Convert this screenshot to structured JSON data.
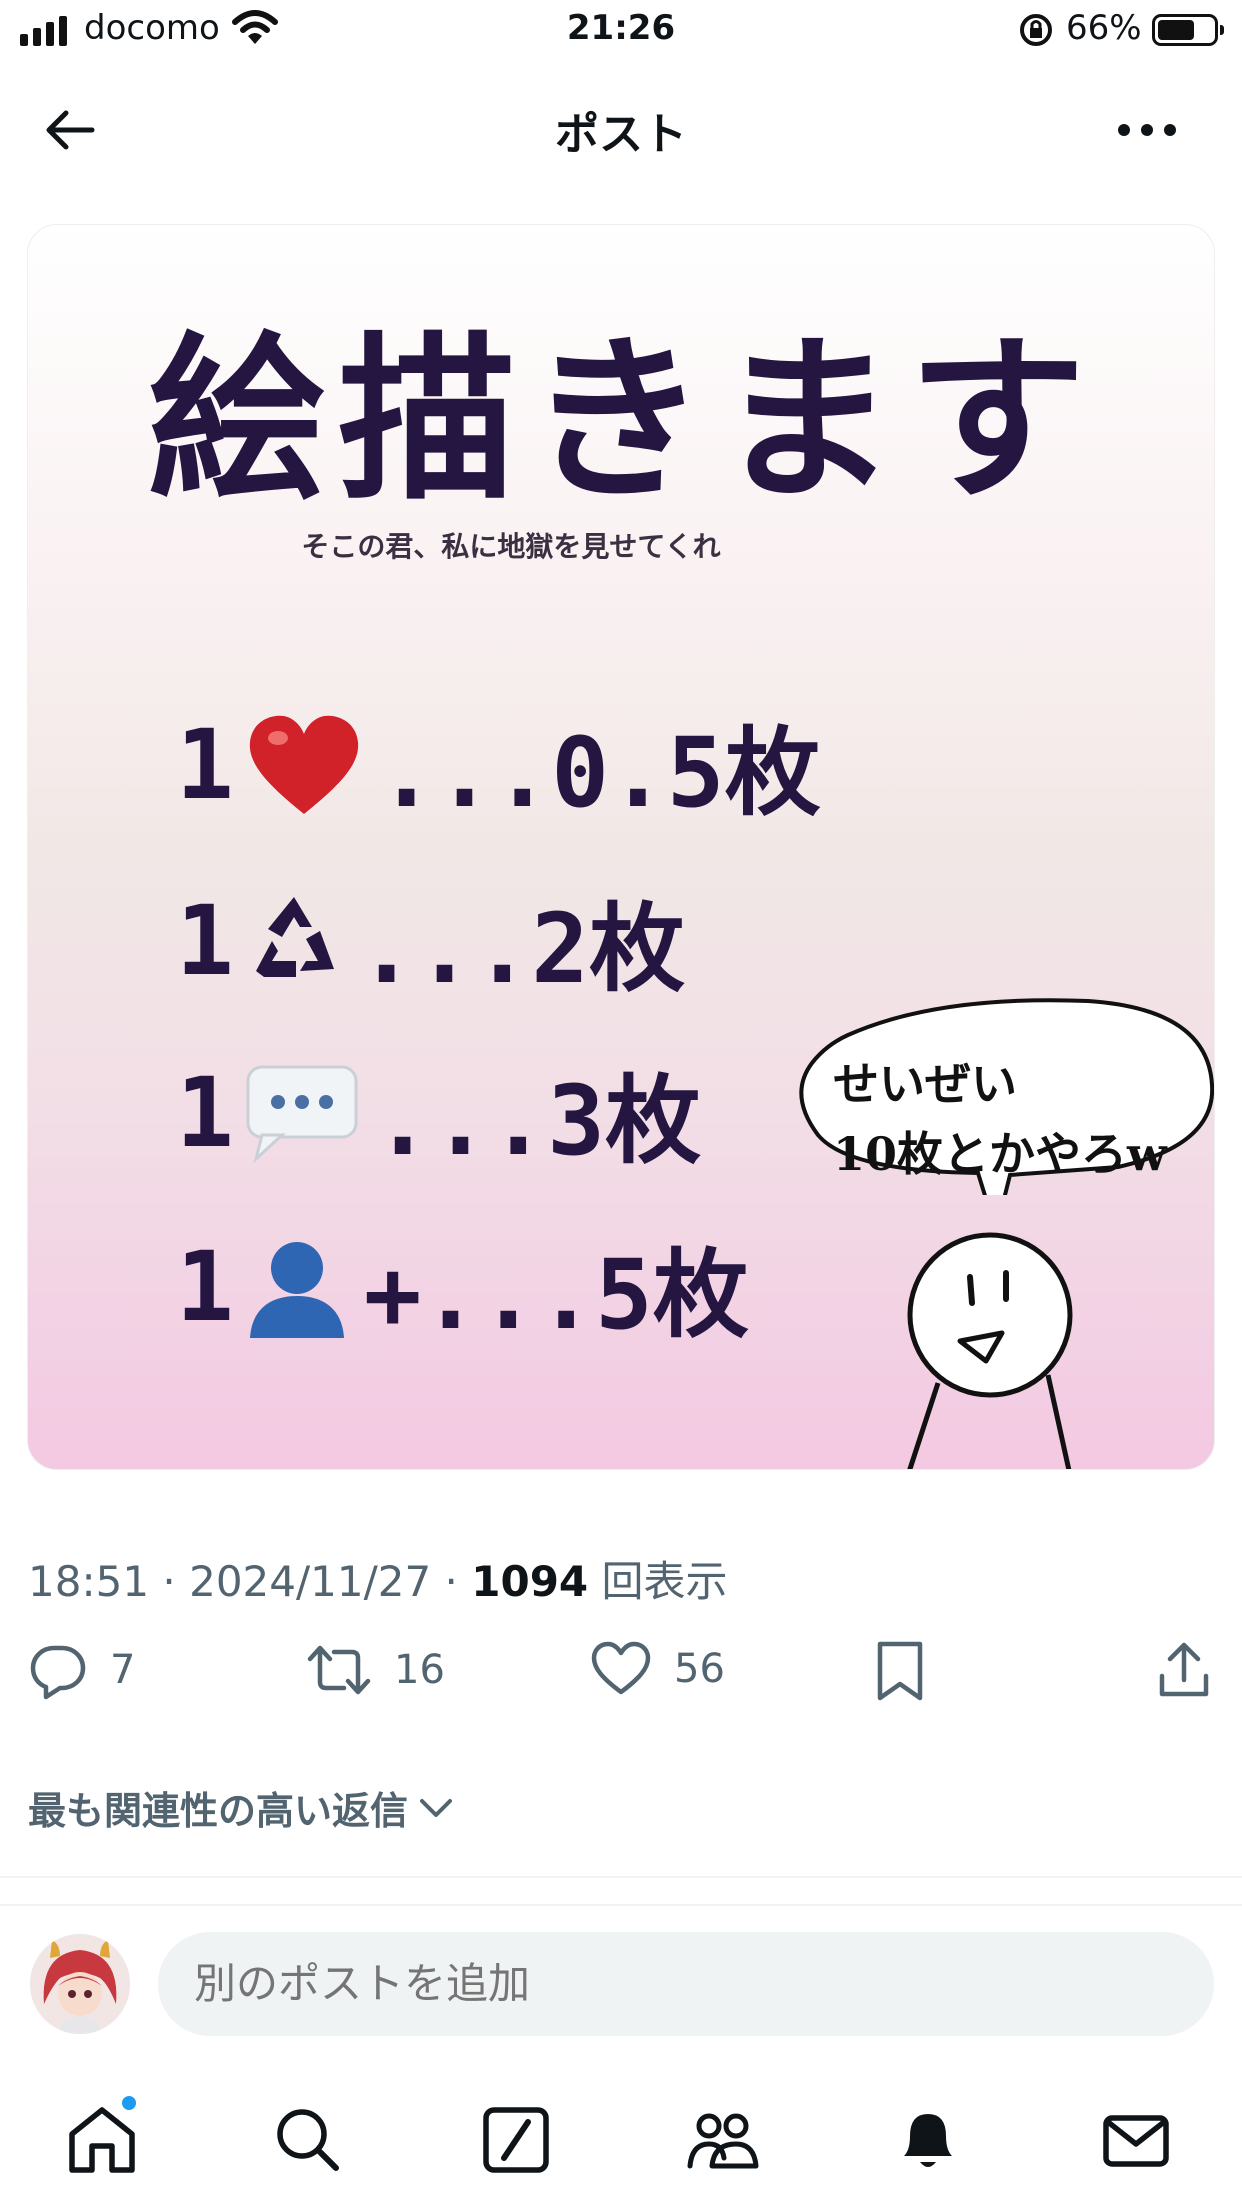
{
  "status_bar": {
    "carrier": "docomo",
    "time": "21:26",
    "battery_percent": "66%",
    "battery_level": 0.66
  },
  "header": {
    "title": "ポスト",
    "back_icon": "arrow-left-icon",
    "more_icon": "ellipsis-icon"
  },
  "post_image": {
    "headline": "絵描きます",
    "subtitle": "そこの君、私に地獄を見せてくれ",
    "rates": [
      {
        "count": "1",
        "icon": "heart-icon",
        "rate": "...0.5枚"
      },
      {
        "count": "1",
        "icon": "recycle-icon",
        "rate": "...2枚"
      },
      {
        "count": "1",
        "icon": "speech-bubble-icon",
        "rate": "...3枚"
      },
      {
        "count": "1",
        "icon": "person-icon",
        "rate": "+...5枚"
      }
    ],
    "speech_line1": "せいぜい",
    "speech_line2": "10枚とかやろw"
  },
  "meta": {
    "time": "18:51",
    "date": "2024/11/27",
    "views_count": "1094",
    "views_label": "回表示"
  },
  "actions": {
    "reply_count": "7",
    "repost_count": "16",
    "like_count": "56"
  },
  "sort_label": "最も関連性の高い返信",
  "reply_input": {
    "placeholder": "別のポストを追加"
  },
  "colors": {
    "accent": "#1d9bf0",
    "headline": "#241641",
    "muted": "#536471"
  },
  "tabs": [
    "home-icon",
    "search-icon",
    "grok-icon",
    "communities-icon",
    "notifications-icon",
    "messages-icon"
  ]
}
